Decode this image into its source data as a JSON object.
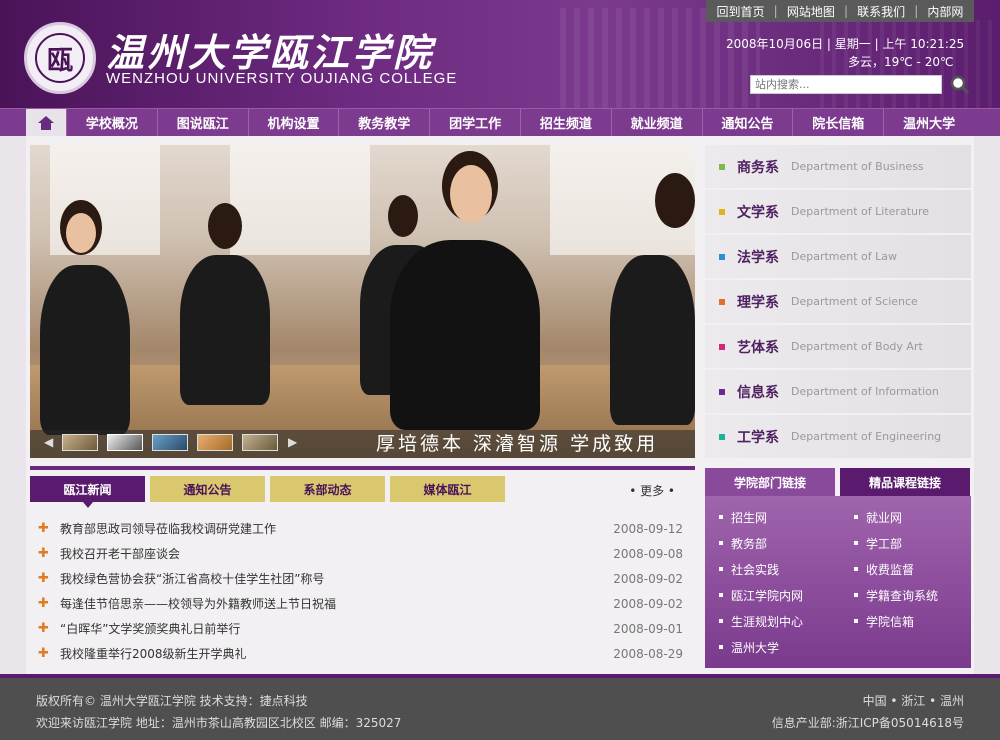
{
  "header": {
    "site_name": "温州大学瓯江学院",
    "site_name_en": "WENZHOU UNIVERSITY OUJIANG COLLEGE",
    "date_line": "2008年10月06日 | 星期一 | 上午 10:21:25",
    "weather_line": "多云，19℃ - 20℃",
    "search_placeholder": "站内搜索...",
    "top_links": [
      "回到首页",
      "网站地图",
      "联系我们",
      "内部网"
    ]
  },
  "nav": {
    "items": [
      "学校概况",
      "图说瓯江",
      "机构设置",
      "教务教学",
      "团学工作",
      "招生频道",
      "就业频道",
      "通知公告",
      "院长信箱",
      "温州大学"
    ]
  },
  "hero": {
    "slogan": "厚培德本  深濬智源  学成致用"
  },
  "departments": [
    {
      "cn": "商务系",
      "en": "Department of Business",
      "color": "#7dbb4f"
    },
    {
      "cn": "文学系",
      "en": "Department of Literature",
      "color": "#e0b41c"
    },
    {
      "cn": "法学系",
      "en": "Department of Law",
      "color": "#2b8fd1"
    },
    {
      "cn": "理学系",
      "en": "Department of Science",
      "color": "#e0702a"
    },
    {
      "cn": "艺体系",
      "en": "Department of Body Art",
      "color": "#d4287a"
    },
    {
      "cn": "信息系",
      "en": "Department of Information",
      "color": "#6a2a8d"
    },
    {
      "cn": "工学系",
      "en": "Department of Engineering",
      "color": "#21b09a"
    }
  ],
  "news": {
    "tabs": [
      "瓯江新闻",
      "通知公告",
      "系部动态",
      "媒体瓯江"
    ],
    "more": "• 更多 •",
    "items": [
      {
        "title": "教育部思政司领导莅临我校调研党建工作",
        "date": "2008-09-12"
      },
      {
        "title": "我校召开老干部座谈会",
        "date": "2008-09-08"
      },
      {
        "title": "我校绿色营协会获“浙江省高校十佳学生社团”称号",
        "date": "2008-09-02"
      },
      {
        "title": "每逢佳节倍思亲——校领导为外籍教师送上节日祝福",
        "date": "2008-09-02"
      },
      {
        "title": "“白晖华”文学奖颁奖典礼日前举行",
        "date": "2008-09-01"
      },
      {
        "title": "我校隆重举行2008级新生开学典礼",
        "date": "2008-08-29"
      }
    ]
  },
  "links": {
    "tabs": [
      "学院部门链接",
      "精品课程链接"
    ],
    "items": [
      "招生网",
      "就业网",
      "教务部",
      "学工部",
      "社会实践",
      "收费监督",
      "瓯江学院内网",
      "学籍查询系统",
      "生涯规划中心",
      "学院信箱",
      "温州大学"
    ]
  },
  "footer": {
    "line1": "版权所有© 温州大学瓯江学院   技术支持：捷点科技",
    "line2": "欢迎来访瓯江学院   地址：温州市茶山高教园区北校区   邮编：325027",
    "right1": "中国 • 浙江 • 温州",
    "right2": "信息产业部:浙江ICP备05014618号"
  }
}
